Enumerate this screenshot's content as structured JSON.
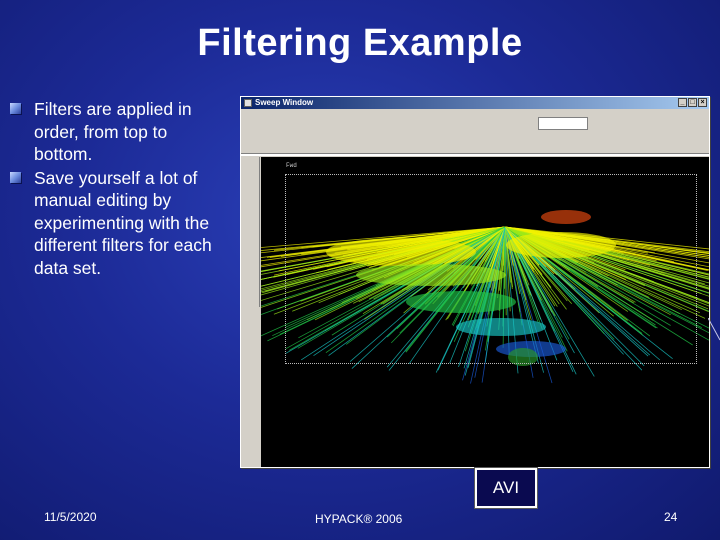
{
  "slide": {
    "title": "Filtering Example",
    "bullets": [
      "Filters are applied in order, from top to bottom.",
      "Save yourself a lot of manual editing by experimenting with the different filters for each data set."
    ]
  },
  "window": {
    "title": "Sweep Window",
    "buttons": [
      "_",
      "□",
      "×"
    ],
    "plot_label": "Fwd"
  },
  "avi_button": {
    "label": "AVI"
  },
  "footer": {
    "date": "11/5/2020",
    "center": "HYPACK® 2006",
    "page": "24"
  },
  "colors": {
    "background": "#1c2a96",
    "accent": "#ffffff",
    "plot_bg": "#000000"
  },
  "icons": {
    "bullet": "square-bullet-icon"
  }
}
